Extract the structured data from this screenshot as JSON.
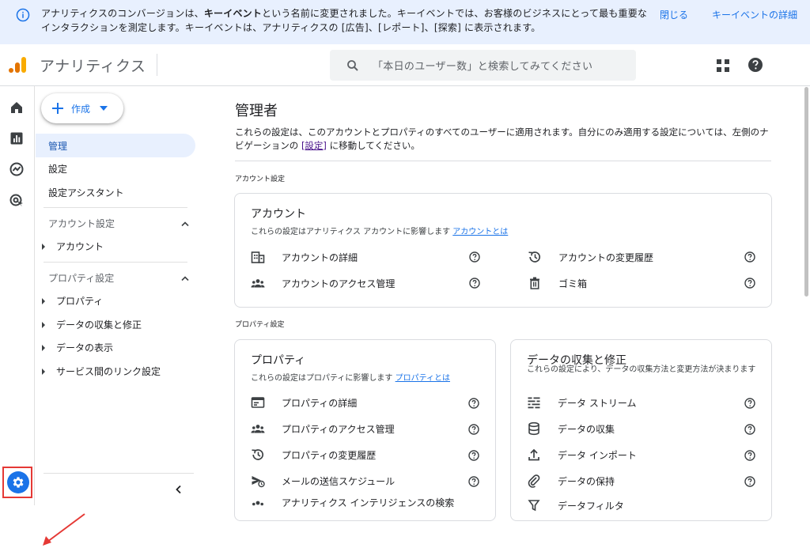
{
  "banner": {
    "message_prefix": "アナリティクスのコンバージョンは、",
    "message_bold": "キーイベント",
    "message_suffix": "という名前に変更されました。キーイベントでは、お客様のビジネスにとって最も重要なインタラクションを測定します。キーイベントは、アナリティクスの [広告]、[レポート]、[探索] に表示されます。",
    "close_label": "閉じる",
    "details_label": "キーイベントの詳細"
  },
  "header": {
    "product_name": "アナリティクス",
    "search_placeholder": "「本日のユーザー数」と検索してみてください"
  },
  "nav": {
    "create_label": "作成",
    "items": [
      {
        "label": "管理",
        "active": true
      },
      {
        "label": "設定",
        "active": false
      },
      {
        "label": "設定アシスタント",
        "active": false
      }
    ],
    "account_section": "アカウント設定",
    "account_items": [
      "アカウント"
    ],
    "property_section": "プロパティ設定",
    "property_items": [
      "プロパティ",
      "データの収集と修正",
      "データの表示",
      "サービス間のリンク設定"
    ]
  },
  "main": {
    "title": "管理者",
    "desc_part1": "これらの設定は、このアカウントとプロパティのすべてのユーザーに適用されます。自分にのみ適用する設定については、左側のナビゲーションの",
    "desc_link": "[設定]",
    "desc_part2": "に移動してください。",
    "account_settings_label": "アカウント設定",
    "account_card": {
      "title": "アカウント",
      "subtitle": "これらの設定はアナリティクス アカウントに影響します",
      "link": "アカウントとは",
      "rows": [
        "アカウントの詳細",
        "アカウントのアクセス管理",
        "アカウントの変更履歴",
        "ゴミ箱"
      ]
    },
    "property_settings_label": "プロパティ設定",
    "property_card": {
      "title": "プロパティ",
      "subtitle": "これらの設定はプロパティに影響します",
      "link": "プロパティとは",
      "rows": [
        "プロパティの詳細",
        "プロパティのアクセス管理",
        "プロパティの変更履歴",
        "メールの送信スケジュール",
        "アナリティクス インテリジェンスの検索"
      ]
    },
    "data_card": {
      "title": "データの収集と修正",
      "subtitle": "これらの設定により、データの収集方法と変更方法が決まります",
      "rows": [
        "データ ストリーム",
        "データの収集",
        "データ インポート",
        "データの保持",
        "データフィルタ"
      ]
    }
  },
  "colors": {
    "accent": "#1a73e8",
    "banner_bg": "#e8f0fe",
    "highlight": "#e53935"
  },
  "icons": [
    "info-icon",
    "analytics-logo-icon",
    "search-icon",
    "apps-grid-icon",
    "help-icon",
    "home-icon",
    "reports-icon",
    "explore-icon",
    "advertising-icon",
    "gear-icon"
  ]
}
